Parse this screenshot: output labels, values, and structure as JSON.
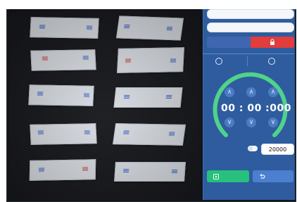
{
  "camera_view": {
    "samples": [
      {
        "marks": [
          {
            "color": "blue"
          },
          {
            "color": "blue"
          }
        ]
      },
      {
        "marks": [
          {
            "color": "blue"
          },
          {
            "color": "blue"
          }
        ]
      },
      {
        "marks": [
          {
            "color": "red"
          },
          {
            "color": "blue"
          }
        ]
      },
      {
        "marks": [
          {
            "color": "red"
          },
          {
            "color": "blue"
          }
        ]
      },
      {
        "marks": [
          {
            "color": "blue"
          },
          {
            "color": "blue"
          }
        ]
      },
      {
        "marks": [
          {
            "color": "blue"
          },
          {
            "color": "blue"
          }
        ]
      },
      {
        "marks": [
          {
            "color": "blue"
          },
          {
            "color": "blue"
          }
        ]
      },
      {
        "marks": [
          {
            "color": "blue"
          },
          {
            "color": "blue"
          }
        ]
      },
      {
        "marks": [
          {
            "color": "blue"
          },
          {
            "color": "red"
          }
        ]
      },
      {
        "marks": [
          {
            "color": "blue"
          },
          {
            "color": "blue"
          }
        ]
      }
    ]
  },
  "control_panel": {
    "input_1_value": "",
    "input_2_value": "",
    "timer_display": "00 : 00 :000",
    "count_value": "20000",
    "colors": {
      "panel_blue": "#2e5c9f",
      "ring_green": "#4fd38a",
      "danger_red": "#e33c3c",
      "success_green": "#27c07c",
      "accent_blue": "#4d7fd0"
    }
  }
}
